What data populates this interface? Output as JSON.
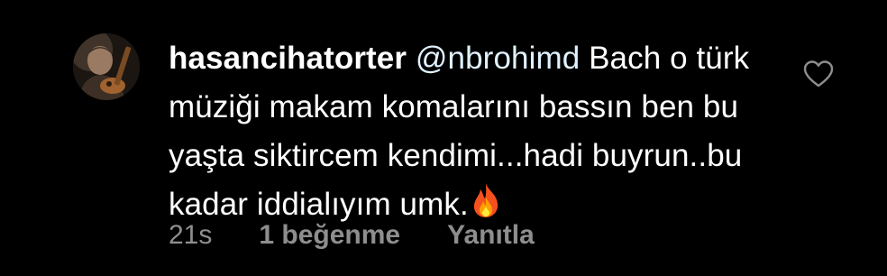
{
  "comment": {
    "username": "hasancihatorter",
    "mention": "@nbrohimd",
    "text": "Bach o türk müziği makam komalarını bassın ben bu yaşta siktircem kendimi...hadi buyrun..bu kadar iddialıyım umk.",
    "emoji_icon": "fire-icon",
    "time": "21s",
    "likes": "1 beğenme",
    "reply_label": "Yanıtla",
    "like_icon": "heart-icon"
  },
  "colors": {
    "background": "#000000",
    "text": "#ffffff",
    "muted": "#8e8e8e",
    "mention": "#e0f1ff"
  }
}
